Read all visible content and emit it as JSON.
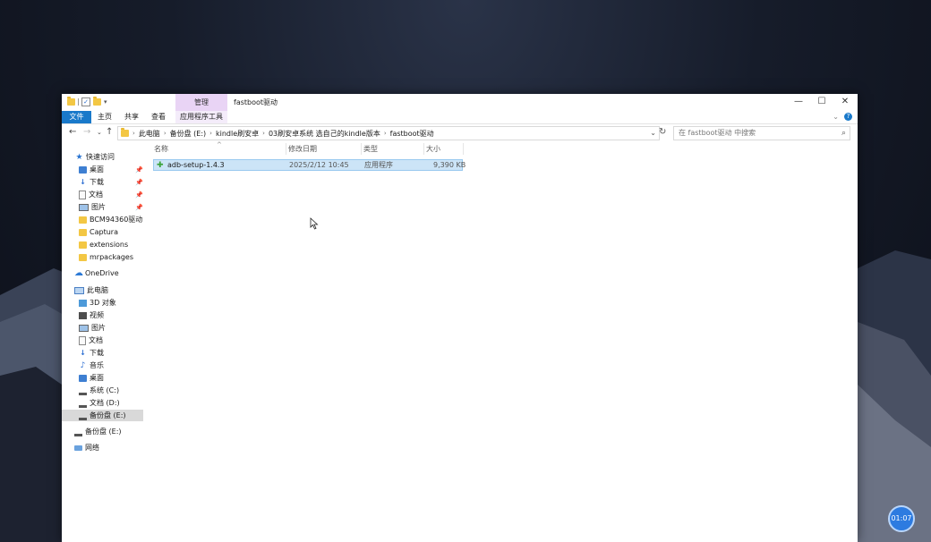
{
  "titlebar": {
    "manage_tab": "管理",
    "title": "fastboot驱动",
    "minimize": "—",
    "maximize": "☐",
    "close": "✕"
  },
  "ribbon": {
    "tabs": [
      "文件",
      "主页",
      "共享",
      "查看",
      "应用程序工具"
    ],
    "help": "?"
  },
  "address": {
    "crumbs": [
      "此电脑",
      "备份盘 (E:)",
      "kindle刷安卓",
      "03刷安卓系统 选自己的kindle版本",
      "fastboot驱动"
    ],
    "search_placeholder": "在 fastboot驱动 中搜索"
  },
  "nav": {
    "quick_access": "快速访问",
    "quick_items": [
      "桌面",
      "下载",
      "文档",
      "图片",
      "BCM94360驱动",
      "Captura",
      "extensions",
      "mrpackages"
    ],
    "onedrive": "OneDrive",
    "this_pc": "此电脑",
    "pc_items": [
      "3D 对象",
      "视频",
      "图片",
      "文档",
      "下载",
      "音乐",
      "桌面",
      "系统 (C:)",
      "文档 (D:)",
      "备份盘 (E:)"
    ],
    "backup_drive": "备份盘 (E:)",
    "network": "网络"
  },
  "columns": {
    "name": "名称",
    "date": "修改日期",
    "type": "类型",
    "size": "大小"
  },
  "files": [
    {
      "name": "adb-setup-1.4.3",
      "date": "2025/2/12 10:45",
      "type": "应用程序",
      "size": "9,390 KB"
    }
  ],
  "timer": "01:07"
}
